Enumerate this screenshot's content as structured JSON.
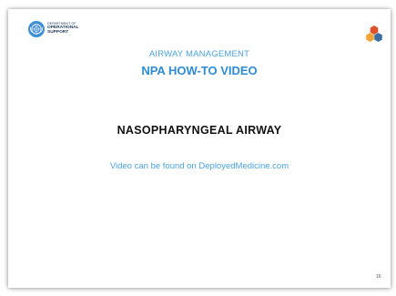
{
  "logo": {
    "line1": "DEPARTMENT OF",
    "line2": "OPERATIONAL",
    "line3": "SUPPORT",
    "icon": "un-emblem-icon",
    "color": "#3f8fd2"
  },
  "brand_icon": {
    "icon": "hexagon-cluster-icon",
    "colors": [
      "#f0a53a",
      "#3b6ea5",
      "#e0522b"
    ]
  },
  "slide": {
    "subtitle": "AIRWAY MANAGEMENT",
    "title": "NPA HOW-TO VIDEO",
    "heading": "NASOPHARYNGEAL AIRWAY",
    "link_text": "Video can be found on DeployedMedicine.com",
    "page_number": "16"
  },
  "colors": {
    "accent_blue": "#2e8bd4",
    "light_blue": "#4aa2dd",
    "heading": "#111111"
  }
}
